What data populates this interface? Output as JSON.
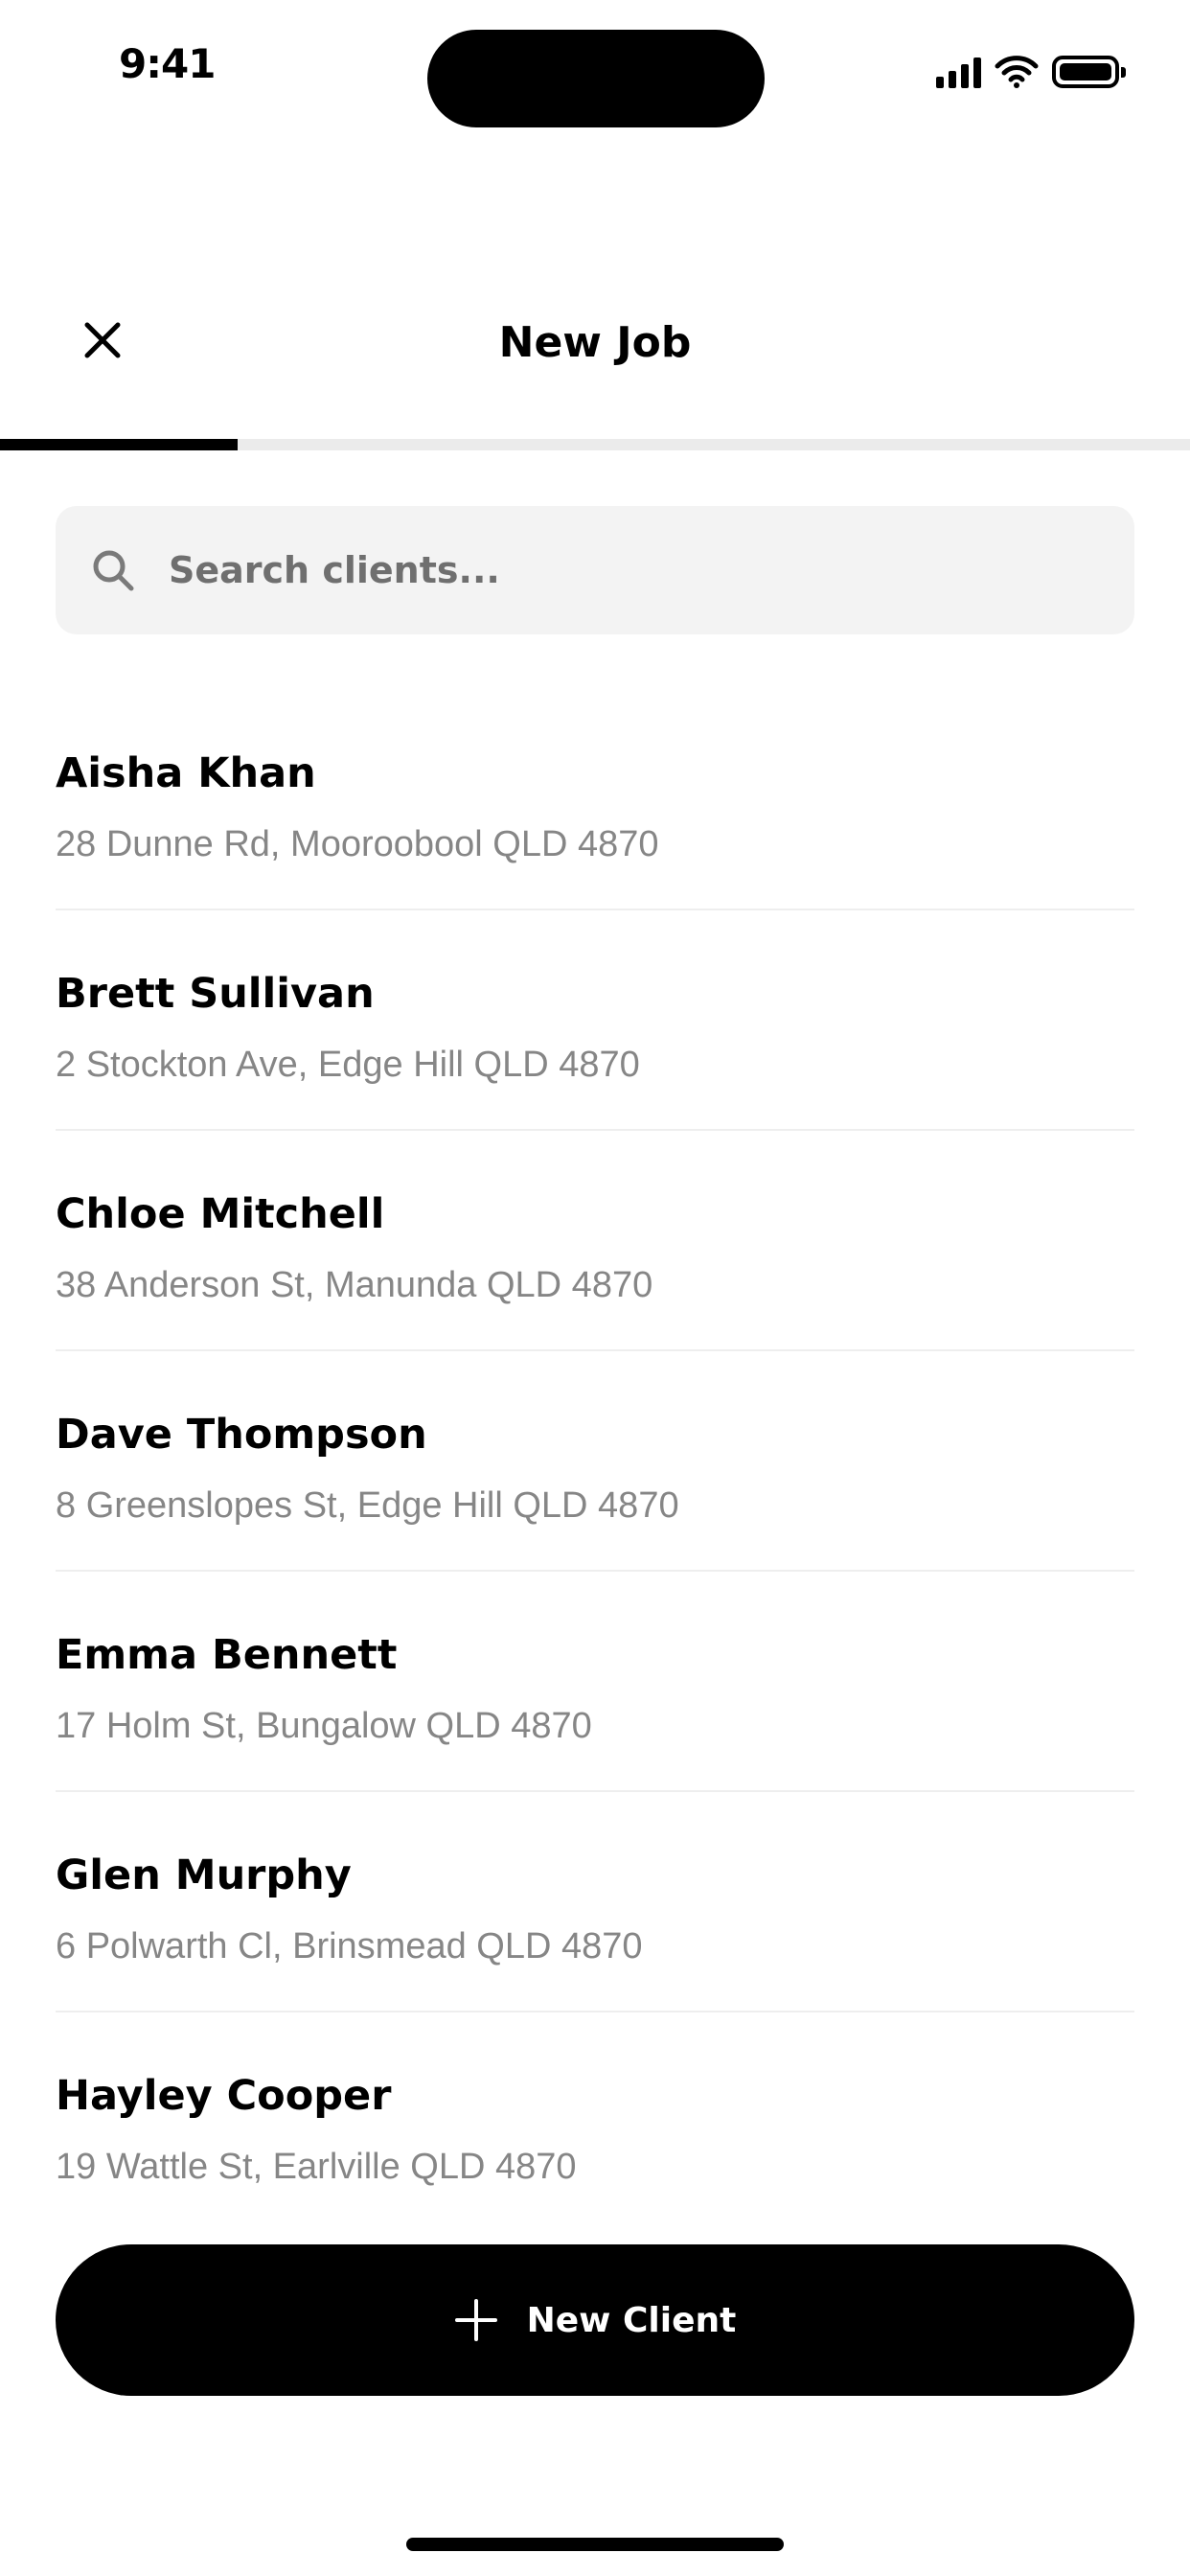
{
  "status_bar": {
    "time": "9:41"
  },
  "header": {
    "title": "New Job",
    "progress_fraction": 0.2
  },
  "search": {
    "placeholder": "Search clients..."
  },
  "clients": [
    {
      "name": "Aisha Khan",
      "address": "28 Dunne Rd, Mooroobool QLD 4870"
    },
    {
      "name": "Brett Sullivan",
      "address": "2 Stockton Ave, Edge Hill QLD 4870"
    },
    {
      "name": "Chloe Mitchell",
      "address": "38 Anderson St, Manunda QLD 4870"
    },
    {
      "name": "Dave Thompson",
      "address": "8 Greenslopes St, Edge Hill QLD 4870"
    },
    {
      "name": "Emma Bennett",
      "address": "17 Holm St, Bungalow QLD 4870"
    },
    {
      "name": "Glen Murphy",
      "address": "6 Polwarth Cl, Brinsmead QLD 4870"
    },
    {
      "name": "Hayley Cooper",
      "address": "19 Wattle St, Earlville QLD 4870"
    }
  ],
  "actions": {
    "new_client_label": "New Client"
  },
  "icons": {
    "close": "close-icon",
    "search": "search-icon",
    "plus": "plus-icon"
  },
  "colors": {
    "accent": "#000000",
    "background": "#ffffff",
    "search_bg": "#f3f3f3",
    "secondary_text": "#868686"
  }
}
